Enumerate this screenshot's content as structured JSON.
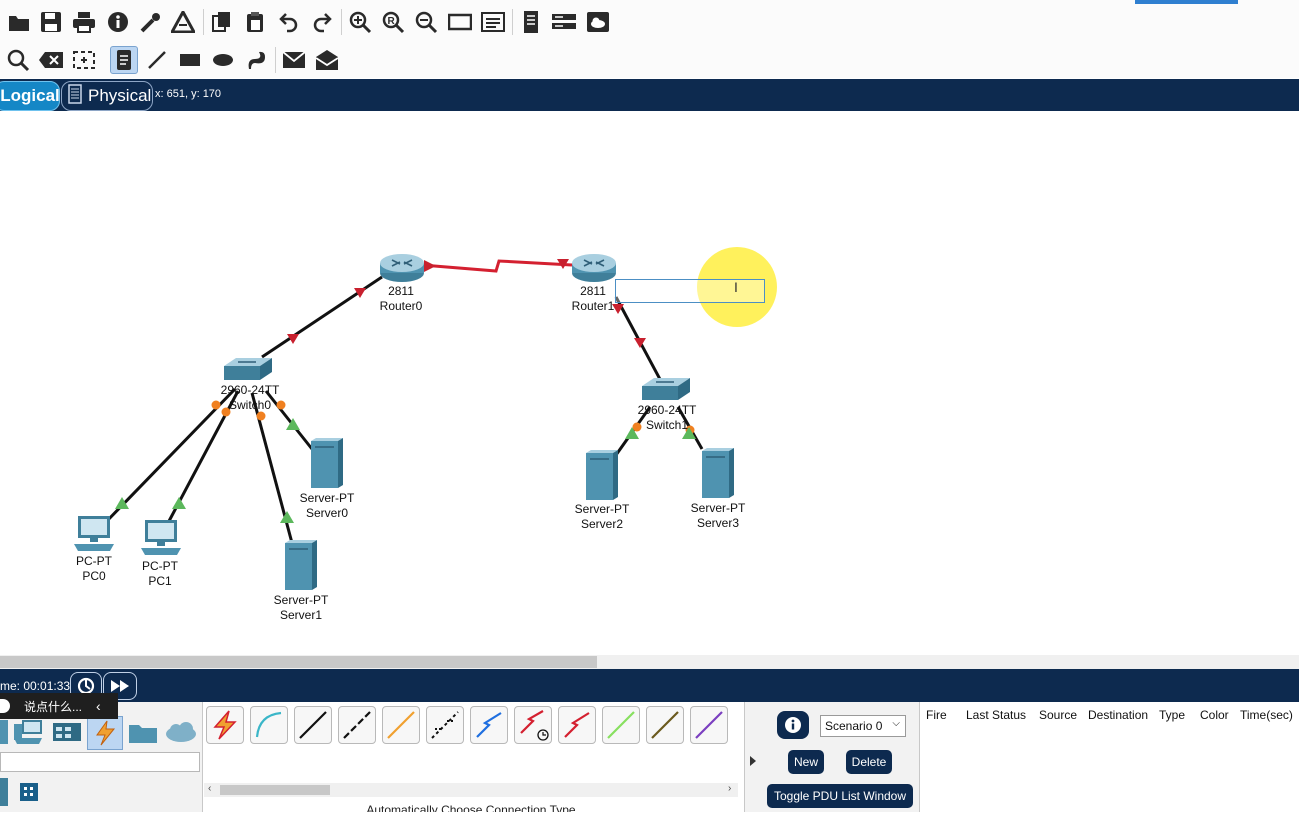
{
  "toolbar_top": {
    "icons": [
      "open-folder-icon",
      "save-icon",
      "print-icon",
      "info-icon",
      "activity-wizard-icon",
      "custom-icon",
      "copy-icon",
      "paste-icon",
      "undo-icon",
      "redo-icon",
      "zoom-in-icon",
      "zoom-reset-icon",
      "zoom-out-icon",
      "drawing-palette-icon",
      "custom-device-icon",
      "viewport-icon",
      "device-dialog-icon",
      "cloud-window-icon"
    ]
  },
  "toolbar_second": {
    "icons": [
      "inspect-icon",
      "delete-icon",
      "resize-icon",
      "place-note-icon",
      "draw-line-icon",
      "draw-rectangle-icon",
      "draw-ellipse-icon",
      "freeform-icon",
      "simple-pdu-icon",
      "complex-pdu-icon"
    ]
  },
  "workspace": {
    "logical_tab": "Logical",
    "physical_tab": "Physical",
    "cursor_coords": "x: 651, y: 170"
  },
  "devices": [
    {
      "id": "router0",
      "model": "2811",
      "name": "Router0"
    },
    {
      "id": "router1",
      "model": "2811",
      "name": "Router1"
    },
    {
      "id": "switch0",
      "model": "2960-24TT",
      "name": "Switch0"
    },
    {
      "id": "switch1",
      "model": "2960-24TT",
      "name": "Switch1"
    },
    {
      "id": "pc0",
      "model": "PC-PT",
      "name": "PC0"
    },
    {
      "id": "pc1",
      "model": "PC-PT",
      "name": "PC1"
    },
    {
      "id": "server0",
      "model": "Server-PT",
      "name": "Server0"
    },
    {
      "id": "server1",
      "model": "Server-PT",
      "name": "Server1"
    },
    {
      "id": "server2",
      "model": "Server-PT",
      "name": "Server2"
    },
    {
      "id": "server3",
      "model": "Server-PT",
      "name": "Server3"
    }
  ],
  "time_bar": {
    "time_label": "me: 00:01:33"
  },
  "chat_popup": {
    "placeholder": "说点什么..."
  },
  "connections": {
    "caption": "Automatically Choose Connection Type",
    "types": [
      "automatic",
      "console",
      "copper-straight",
      "copper-cross",
      "fiber",
      "phone",
      "coaxial",
      "serial-dce",
      "serial-dte",
      "octal",
      "iot",
      "usb"
    ],
    "colors": [
      "#e8a33a",
      "#3ab6c8",
      "#111111",
      "#111111",
      "#f0a030",
      "#111111",
      "#1f6fe0",
      "#d42030",
      "#d42030",
      "#88e060",
      "#6b5a1e",
      "#7b3fc0"
    ]
  },
  "scenario": {
    "selected": "Scenario 0",
    "new_label": "New",
    "delete_label": "Delete",
    "toggle_label": "Toggle PDU List Window"
  },
  "pdu_table": {
    "headers": [
      "Fire",
      "Last Status",
      "Source",
      "Destination",
      "Type",
      "Color",
      "Time(sec)"
    ]
  },
  "colors": {
    "toolbar_blue": "#0d2a4f",
    "link_black": "#111111",
    "serial_red": "#d42030",
    "port_up": "#5cb85c",
    "port_down_red": "#c8202e",
    "port_blocking": "#f08020",
    "highlight": "#ffef40"
  }
}
